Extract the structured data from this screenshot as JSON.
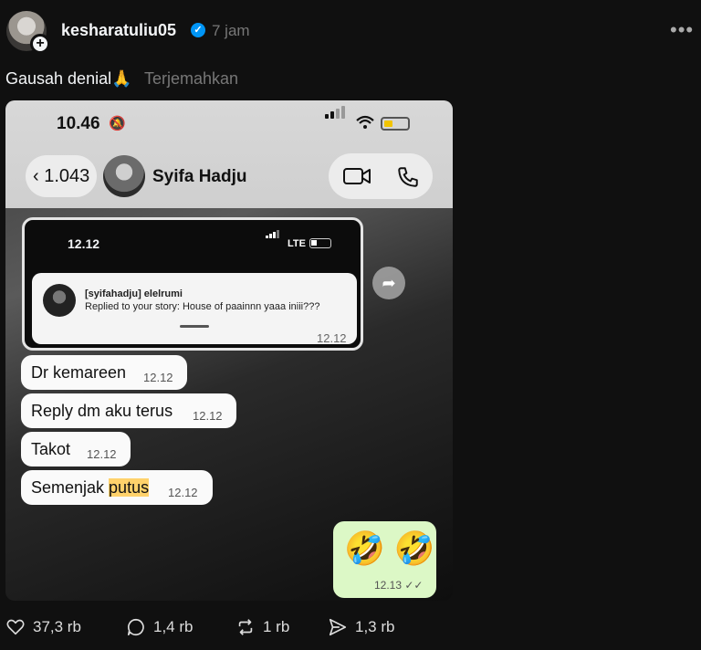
{
  "post": {
    "username": "kesharatuliu05",
    "time_ago": "7 jam",
    "caption": "Gausah denial🙏",
    "translate_label": "Terjemahkan"
  },
  "screenshot": {
    "status_time": "10.46",
    "back_count": "1.043",
    "contact_name": "Syifa Hadju",
    "story": {
      "status_time": "12.12",
      "network": "LTE",
      "title": "[syifahadju] elelrumi",
      "text": "Replied to your story: House of paainnn yaaa iniii???",
      "timestamp": "12.12"
    },
    "messages": [
      {
        "text": "Dr kemareen",
        "time": "12.12"
      },
      {
        "text": "Reply dm aku terus",
        "time": "12.12"
      },
      {
        "text": "Takot",
        "time": "12.12"
      },
      {
        "text_before": "Semenjak ",
        "text_highlight": "putus",
        "time": "12.12"
      }
    ],
    "outgoing": {
      "emoji": "🤣 🤣",
      "time": "12.13 ✓✓"
    }
  },
  "actions": {
    "likes": "37,3 rb",
    "comments": "1,4 rb",
    "reposts": "1 rb",
    "shares": "1,3 rb"
  }
}
